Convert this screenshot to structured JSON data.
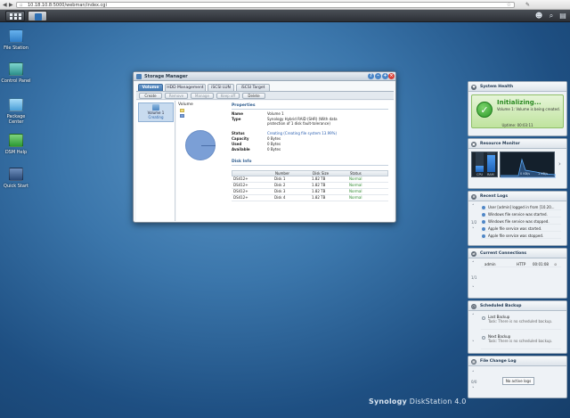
{
  "browser": {
    "url": "10.18.10.8:5000/webman/index.cgi"
  },
  "desktop_icons": [
    {
      "label": "File Station",
      "icon": "folder-icon",
      "color": "#3d8fd8"
    },
    {
      "label": "Control Panel",
      "icon": "control-panel-icon",
      "color": "#3aa7a0"
    },
    {
      "label": "Package Center",
      "icon": "package-icon",
      "color": "#5bb0e8"
    },
    {
      "label": "DSM Help",
      "icon": "help-icon",
      "color": "#3fae45"
    },
    {
      "label": "Quick Start",
      "icon": "wizard-icon",
      "color": "#3a5c8c"
    }
  ],
  "storage_manager": {
    "title": "Storage Manager",
    "tabs": [
      "Volume",
      "HDD Management",
      "iSCSI LUN",
      "iSCSI Target"
    ],
    "toolbar": [
      "Create",
      "Remove",
      "Manage",
      "Keep off",
      "Delete"
    ],
    "left_pane": {
      "name": "Volume 1",
      "status": "Creating"
    },
    "volume_header": "Volume",
    "properties": {
      "header": "Properties",
      "rows": [
        {
          "label": "Name",
          "value": "Volume 1"
        },
        {
          "label": "Type",
          "value": "Synology Hybrid RAID (SHR) (With data protection of 1 disk fault-tolerance)"
        },
        {
          "label": "Status",
          "value": "Creating (Creating file system 13.99%)"
        },
        {
          "label": "Capacity",
          "value": "0 Bytes"
        },
        {
          "label": "Used",
          "value": "0 Bytes"
        },
        {
          "label": "Available",
          "value": "0 Bytes"
        }
      ]
    },
    "disk_info": {
      "header": "Disk Info",
      "columns": [
        "",
        "Number",
        "Disk Size",
        "Status"
      ],
      "rows": [
        [
          "DS412+",
          "Disk 1",
          "1.82 TB",
          "Normal"
        ],
        [
          "DS412+",
          "Disk 2",
          "1.82 TB",
          "Normal"
        ],
        [
          "DS412+",
          "Disk 3",
          "1.82 TB",
          "Normal"
        ],
        [
          "DS412+",
          "Disk 4",
          "1.82 TB",
          "Normal"
        ]
      ]
    }
  },
  "widgets": {
    "system_health": {
      "title": "System Health",
      "state": "Initializing...",
      "message": "Volume 1: Volume is being created.",
      "uptime": "Uptime: 00:03:11"
    },
    "resource_monitor": {
      "title": "Resource Monitor",
      "cpu_label": "CPU",
      "ram_label": "RAM",
      "cpu_level": 0.3,
      "ram_level": 0.85,
      "net_up": "0 KB/s",
      "net_down": "1 KB/s"
    },
    "recent_logs": {
      "title": "Recent Logs",
      "page": "1/2",
      "items": [
        "User [admin] logged in from [10.20...",
        "Windows file service was started.",
        "Windows file service was stopped.",
        "Apple file service was started.",
        "Apple file service was stopped."
      ]
    },
    "current_connections": {
      "title": "Current Connections",
      "page": "1/1",
      "row": {
        "user": "admin",
        "type": "HTTP",
        "time": "00:01:08"
      }
    },
    "scheduled_backup": {
      "title": "Scheduled Backup",
      "items": [
        {
          "name": "Last Backup",
          "detail": "Task: There is no scheduled backup."
        },
        {
          "name": "Next Backup",
          "detail": "Task: There is no scheduled backup."
        }
      ]
    },
    "file_change_log": {
      "title": "File Change Log",
      "page": "0/0",
      "empty": "No active logs"
    }
  },
  "brand": {
    "name": "Synology",
    "product": "DiskStation 4.0"
  }
}
